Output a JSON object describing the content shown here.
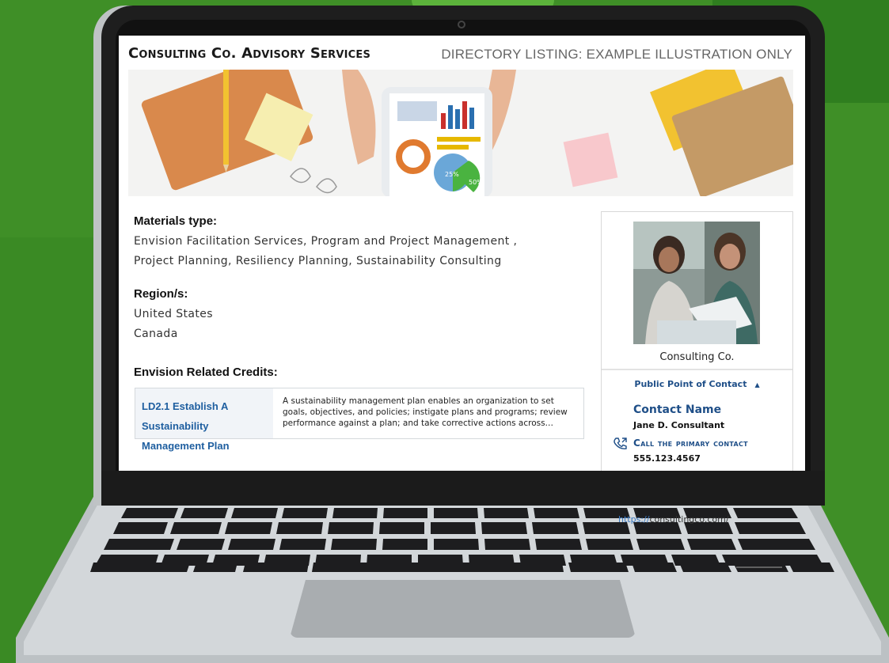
{
  "header": {
    "title": "Consulting Co. Advisory Services",
    "note": "DIRECTORY LISTING: EXAMPLE ILLUSTRATION ONLY"
  },
  "banner": {
    "chart_labels": [
      "25%",
      "50%"
    ]
  },
  "materials": {
    "label": "Materials type:",
    "line1": "Envision Facilitation Services, Program and Project Management ,",
    "line2": "Project Planning, Resiliency Planning, Sustainability Consulting"
  },
  "regions": {
    "label": "Region/s:",
    "items": [
      "United States",
      "Canada"
    ]
  },
  "credits": {
    "label": "Envision Related Credits:",
    "rows": [
      {
        "code_title_line1": "LD2.1 Establish A Sustainability",
        "code_title_line2": "Management Plan",
        "description": "A sustainability management plan enables an organization to set goals, objectives, and policies; instigate plans and programs; review performance against a plan; and take corrective actions across…"
      }
    ]
  },
  "card": {
    "company": "Consulting Co.",
    "poc_toggle": "Public Point of Contact",
    "contact_label": "Contact Name",
    "contact_name": "Jane D. Consultant",
    "call_label": "Call the primary contact",
    "phone": "555.123.4567"
  },
  "url": {
    "protocol": "https://",
    "host": "consultingco.com/"
  },
  "colors": {
    "background": "#4a9a2e",
    "accent_blue": "#1f4f88",
    "link_blue": "#1f5fa0"
  }
}
